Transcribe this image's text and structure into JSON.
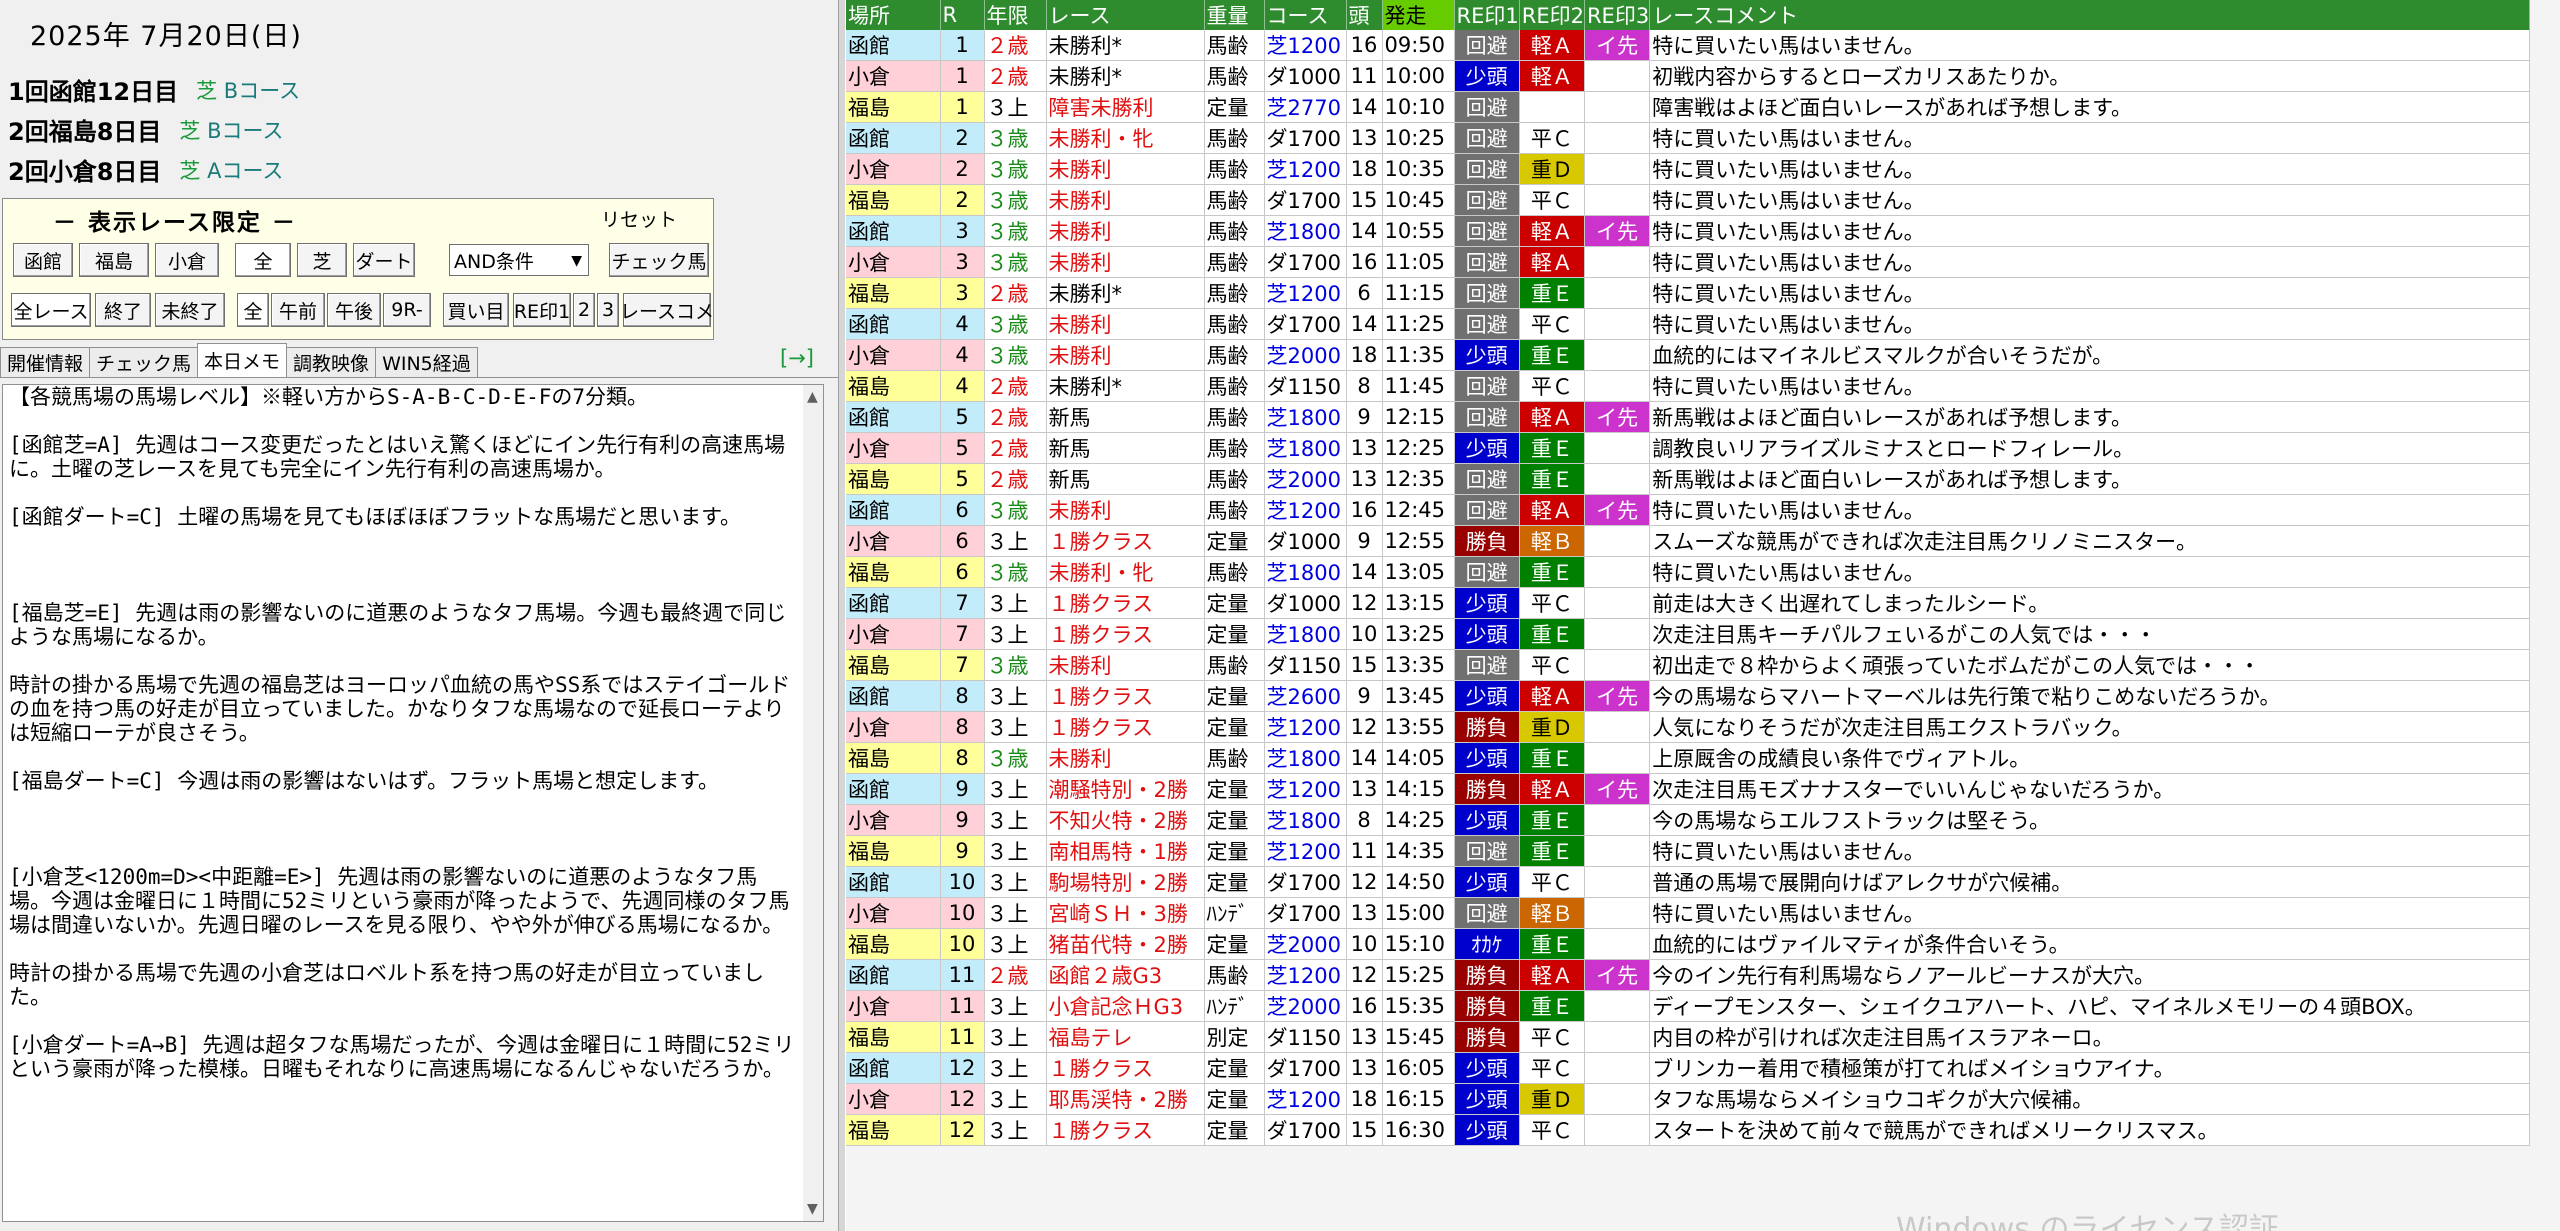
{
  "date": "2025年 7月20日(日)",
  "meetings": [
    {
      "name": "1回函館12日目",
      "course_type": "芝",
      "course": "Bコース"
    },
    {
      "name": "2回福島8日目",
      "course_type": "芝",
      "course": "Bコース"
    },
    {
      "name": "2回小倉8日目",
      "course_type": "芝",
      "course": "Aコース"
    }
  ],
  "filter": {
    "title": "－ 表示レース限定 －",
    "reset": "リセット",
    "venues": [
      "函館",
      "福島",
      "小倉"
    ],
    "surface": [
      "全",
      "芝",
      "ダート"
    ],
    "condition": "AND条件",
    "check_btn": "チェック馬",
    "status": [
      "全レース",
      "終了",
      "未終了"
    ],
    "time": [
      "全",
      "午前",
      "午後",
      "9R-"
    ],
    "buy": "買い目",
    "marks": [
      "RE印1",
      "2",
      "3"
    ],
    "comment": "レースコメ"
  },
  "tabs": [
    "開催情報",
    "チェック馬",
    "本日メモ",
    "調教映像",
    "WIN5経過"
  ],
  "tab_arrow": "[→]",
  "memo": "【各競馬場の馬場レベル】※軽い方からS-A-B-C-D-E-Fの7分類。\n\n[函館芝=A] 先週はコース変更だったとはいえ驚くほどにイン先行有利の高速馬場に。土曜の芝レースを見ても完全にイン先行有利の高速馬場か。\n\n[函館ダート=C] 土曜の馬場を見てもほぼほぼフラットな馬場だと思います。\n\n\n\n[福島芝=E] 先週は雨の影響ないのに道悪のようなタフ馬場。今週も最終週で同じような馬場になるか。\n\n時計の掛かる馬場で先週の福島芝はヨーロッパ血統の馬やSS系ではステイゴールドの血を持つ馬の好走が目立っていました。かなりタフな馬場なので延長ローテよりは短縮ローテが良さそう。\n\n[福島ダート=C] 今週は雨の影響はないはず。フラット馬場と想定します。\n\n\n\n[小倉芝<1200m=D><中距離=E>] 先週は雨の影響ないのに道悪のようなタフ馬場。今週は金曜日に１時間に52ミリという豪雨が降ったようで、先週同様のタフ馬場は間違いないか。先週日曜のレースを見る限り、やや外が伸びる馬場になるか。\n\n時計の掛かる馬場で先週の小倉芝はロベルト系を持つ馬の好走が目立っていました。\n\n[小倉ダート=A→B] 先週は超タフな馬場だったが、今週は金曜日に１時間に52ミリという豪雨が降った模様。日曜もそれなりに高速馬場になるんじゃないだろうか。",
  "table": {
    "headers": [
      "場所",
      "R",
      "年限",
      "レース",
      "重量",
      "コース",
      "頭",
      "発走",
      "RE印1",
      "RE印2",
      "RE印3",
      "レースコメント"
    ],
    "rows": [
      [
        "函館",
        "1",
        "２歳",
        "未勝利*",
        "馬齢",
        "芝1200",
        "16",
        "09:50",
        "回避",
        "軽Ａ",
        "イ先",
        "特に買いたい馬はいません。"
      ],
      [
        "小倉",
        "1",
        "２歳",
        "未勝利*",
        "馬齢",
        "ダ1000",
        "11",
        "10:00",
        "少頭",
        "軽Ａ",
        "",
        "初戦内容からするとローズカリスあたりか。"
      ],
      [
        "福島",
        "1",
        "３上",
        "障害未勝利",
        "定量",
        "芝2770",
        "14",
        "10:10",
        "回避",
        "",
        "",
        "障害戦はよほど面白いレースがあれば予想します。"
      ],
      [
        "函館",
        "2",
        "３歳",
        "未勝利・牝",
        "馬齢",
        "ダ1700",
        "13",
        "10:25",
        "回避",
        "平Ｃ",
        "",
        "特に買いたい馬はいません。"
      ],
      [
        "小倉",
        "2",
        "３歳",
        "未勝利",
        "馬齢",
        "芝1200",
        "18",
        "10:35",
        "回避",
        "重Ｄ",
        "",
        "特に買いたい馬はいません。"
      ],
      [
        "福島",
        "2",
        "３歳",
        "未勝利",
        "馬齢",
        "ダ1700",
        "15",
        "10:45",
        "回避",
        "平Ｃ",
        "",
        "特に買いたい馬はいません。"
      ],
      [
        "函館",
        "3",
        "３歳",
        "未勝利",
        "馬齢",
        "芝1800",
        "14",
        "10:55",
        "回避",
        "軽Ａ",
        "イ先",
        "特に買いたい馬はいません。"
      ],
      [
        "小倉",
        "3",
        "３歳",
        "未勝利",
        "馬齢",
        "ダ1700",
        "16",
        "11:05",
        "回避",
        "軽Ａ",
        "",
        "特に買いたい馬はいません。"
      ],
      [
        "福島",
        "3",
        "２歳",
        "未勝利*",
        "馬齢",
        "芝1200",
        "6",
        "11:15",
        "回避",
        "重Ｅ",
        "",
        "特に買いたい馬はいません。"
      ],
      [
        "函館",
        "4",
        "３歳",
        "未勝利",
        "馬齢",
        "ダ1700",
        "14",
        "11:25",
        "回避",
        "平Ｃ",
        "",
        "特に買いたい馬はいません。"
      ],
      [
        "小倉",
        "4",
        "３歳",
        "未勝利",
        "馬齢",
        "芝2000",
        "18",
        "11:35",
        "少頭",
        "重Ｅ",
        "",
        "血統的にはマイネルビスマルクが合いそうだが。"
      ],
      [
        "福島",
        "4",
        "２歳",
        "未勝利*",
        "馬齢",
        "ダ1150",
        "8",
        "11:45",
        "回避",
        "平Ｃ",
        "",
        "特に買いたい馬はいません。"
      ],
      [
        "函館",
        "5",
        "２歳",
        "新馬",
        "馬齢",
        "芝1800",
        "9",
        "12:15",
        "回避",
        "軽Ａ",
        "イ先",
        "新馬戦はよほど面白いレースがあれば予想します。"
      ],
      [
        "小倉",
        "5",
        "２歳",
        "新馬",
        "馬齢",
        "芝1800",
        "13",
        "12:25",
        "少頭",
        "重Ｅ",
        "",
        "調教良いリアライズルミナスとロードフィレール。"
      ],
      [
        "福島",
        "5",
        "２歳",
        "新馬",
        "馬齢",
        "芝2000",
        "13",
        "12:35",
        "回避",
        "重Ｅ",
        "",
        "新馬戦はよほど面白いレースがあれば予想します。"
      ],
      [
        "函館",
        "6",
        "３歳",
        "未勝利",
        "馬齢",
        "芝1200",
        "16",
        "12:45",
        "回避",
        "軽Ａ",
        "イ先",
        "特に買いたい馬はいません。"
      ],
      [
        "小倉",
        "6",
        "３上",
        "１勝クラス",
        "定量",
        "ダ1000",
        "9",
        "12:55",
        "勝負",
        "軽Ｂ",
        "",
        "スムーズな競馬ができれば次走注目馬クリノミニスター。"
      ],
      [
        "福島",
        "6",
        "３歳",
        "未勝利・牝",
        "馬齢",
        "芝1800",
        "14",
        "13:05",
        "回避",
        "重Ｅ",
        "",
        "特に買いたい馬はいません。"
      ],
      [
        "函館",
        "7",
        "３上",
        "１勝クラス",
        "定量",
        "ダ1000",
        "12",
        "13:15",
        "少頭",
        "平Ｃ",
        "",
        "前走は大きく出遅れてしまったルシード。"
      ],
      [
        "小倉",
        "7",
        "３上",
        "１勝クラス",
        "定量",
        "芝1800",
        "10",
        "13:25",
        "少頭",
        "重Ｅ",
        "",
        "次走注目馬キーチパルフェいるがこの人気では・・・"
      ],
      [
        "福島",
        "7",
        "３歳",
        "未勝利",
        "馬齢",
        "ダ1150",
        "15",
        "13:35",
        "回避",
        "平Ｃ",
        "",
        "初出走で８枠からよく頑張っていたボムだがこの人気では・・・"
      ],
      [
        "函館",
        "8",
        "３上",
        "１勝クラス",
        "定量",
        "芝2600",
        "9",
        "13:45",
        "少頭",
        "軽Ａ",
        "イ先",
        "今の馬場ならマハートマーベルは先行策で粘りこめないだろうか。"
      ],
      [
        "小倉",
        "8",
        "３上",
        "１勝クラス",
        "定量",
        "芝1200",
        "12",
        "13:55",
        "勝負",
        "重Ｄ",
        "",
        "人気になりそうだが次走注目馬エクストラバック。"
      ],
      [
        "福島",
        "8",
        "３歳",
        "未勝利",
        "馬齢",
        "芝1800",
        "14",
        "14:05",
        "少頭",
        "重Ｅ",
        "",
        "上原厩舎の成績良い条件でヴィアトル。"
      ],
      [
        "函館",
        "9",
        "３上",
        "潮騒特別・2勝",
        "定量",
        "芝1200",
        "13",
        "14:15",
        "勝負",
        "軽Ａ",
        "イ先",
        "次走注目馬モズナナスターでいいんじゃないだろうか。"
      ],
      [
        "小倉",
        "9",
        "３上",
        "不知火特・2勝",
        "定量",
        "芝1800",
        "8",
        "14:25",
        "少頭",
        "重Ｅ",
        "",
        "今の馬場ならエルフストラックは堅そう。"
      ],
      [
        "福島",
        "9",
        "３上",
        "南相馬特・1勝",
        "定量",
        "芝1200",
        "11",
        "14:35",
        "回避",
        "重Ｅ",
        "",
        "特に買いたい馬はいません。"
      ],
      [
        "函館",
        "10",
        "３上",
        "駒場特別・2勝",
        "定量",
        "ダ1700",
        "12",
        "14:50",
        "少頭",
        "平Ｃ",
        "",
        "普通の馬場で展開向けばアレクサが穴候補。"
      ],
      [
        "小倉",
        "10",
        "３上",
        "宮崎ＳＨ・3勝",
        "ﾊﾝﾃﾞ",
        "ダ1700",
        "13",
        "15:00",
        "回避",
        "軽Ｂ",
        "",
        "特に買いたい馬はいません。"
      ],
      [
        "福島",
        "10",
        "３上",
        "猪苗代特・2勝",
        "定量",
        "芝2000",
        "10",
        "15:10",
        "ｵｶｹ",
        "重Ｅ",
        "",
        "血統的にはヴァイルマティが条件合いそう。"
      ],
      [
        "函館",
        "11",
        "２歳",
        "函館２歳G3",
        "馬齢",
        "芝1200",
        "12",
        "15:25",
        "勝負",
        "軽Ａ",
        "イ先",
        "今のイン先行有利馬場ならノアールビーナスが大穴。"
      ],
      [
        "小倉",
        "11",
        "３上",
        "小倉記念ＨG3",
        "ﾊﾝﾃﾞ",
        "芝2000",
        "16",
        "15:35",
        "勝負",
        "重Ｅ",
        "",
        "ディープモンスター、シェイクユアハート、ハピ、マイネルメモリーの４頭BOX。"
      ],
      [
        "福島",
        "11",
        "３上",
        "福島テレ",
        "別定",
        "ダ1150",
        "13",
        "15:45",
        "勝負",
        "平Ｃ",
        "",
        "内目の枠が引ければ次走注目馬イスラアネーロ。"
      ],
      [
        "函館",
        "12",
        "３上",
        "１勝クラス",
        "定量",
        "ダ1700",
        "13",
        "16:05",
        "少頭",
        "平Ｃ",
        "",
        "ブリンカー着用で積極策が打てればメイショウアイナ。"
      ],
      [
        "小倉",
        "12",
        "３上",
        "耶馬渓特・2勝",
        "定量",
        "芝1200",
        "18",
        "16:15",
        "少頭",
        "重Ｄ",
        "",
        "タフな馬場ならメイショウコギクが大穴候補。"
      ],
      [
        "福島",
        "12",
        "３上",
        "１勝クラス",
        "定量",
        "ダ1700",
        "15",
        "16:30",
        "少頭",
        "平Ｃ",
        "",
        "スタートを決めて前々で競馬ができればメリークリスマス。"
      ]
    ]
  },
  "watermark": "Windows のライセンス認証"
}
